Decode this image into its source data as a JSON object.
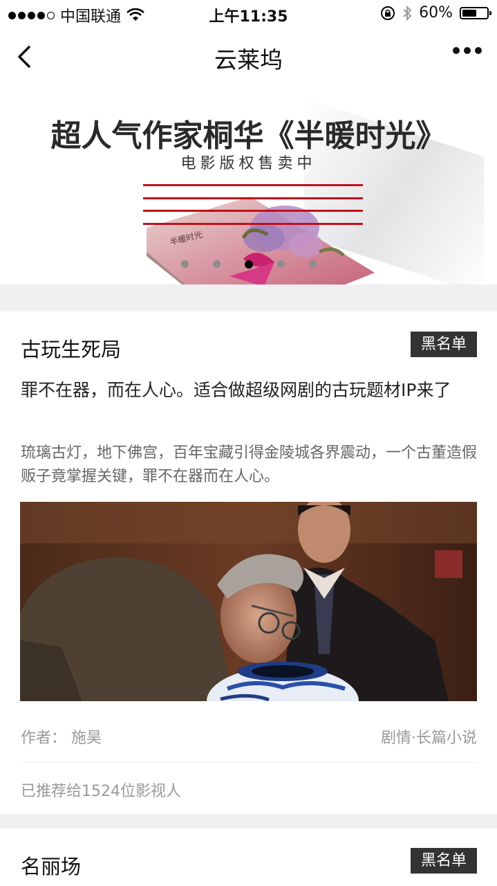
{
  "status_bar": {
    "carrier": "中国联通",
    "time": "上午11:35",
    "battery": "60%",
    "battery_level": 0.6
  },
  "nav": {
    "title": "云莱坞"
  },
  "banner": {
    "title": "超人气作家桐华《半暖时光》",
    "subtitle": "电影版权售卖中",
    "book_cover_title": "半暖时光",
    "slide_count": 5,
    "active_slide": 3
  },
  "cards": [
    {
      "title": "古玩生死局",
      "badge": "黑名单",
      "headline": "罪不在器，而在人心。适合做超级网剧的古玩题材IP来了",
      "description": "琉璃古灯，地下佛宫，百年宝藏引得金陵城各界震动，一个古董造假贩子竟掌握关键，罪不在器而在人心。",
      "author": "作者：  施昊",
      "genre": "剧情·长篇小说",
      "recommended": "已推荐给1524位影视人"
    },
    {
      "title": "名丽场",
      "badge": "黑名单"
    }
  ],
  "colors": {
    "badge_bg": "#333333",
    "accent_red": "#c0111c",
    "page_bg": "#f0f0f0"
  }
}
